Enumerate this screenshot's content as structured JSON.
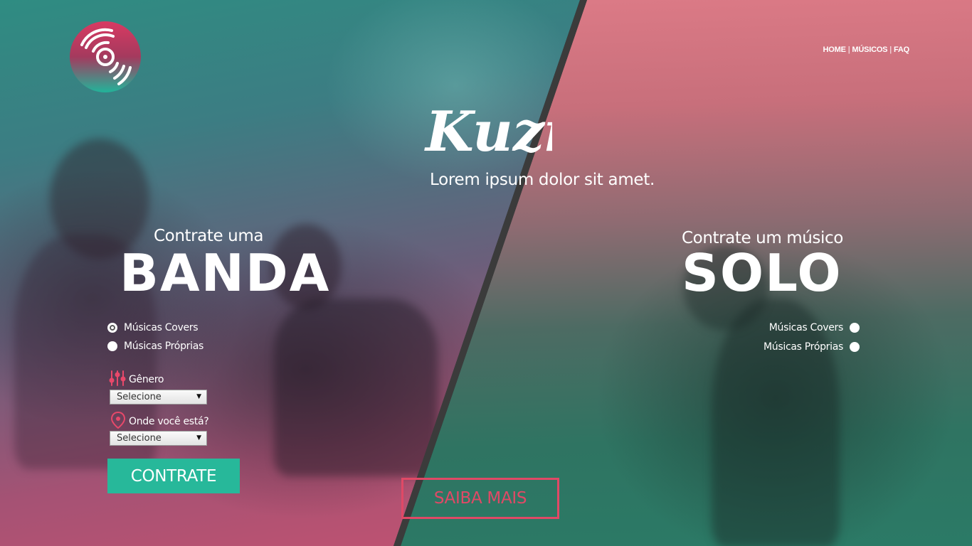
{
  "nav": {
    "home": "HOME",
    "musicos": "MÚSICOS",
    "faq": "FAQ",
    "separator": "|"
  },
  "brand": {
    "name": "Kuziq",
    "tagline": "Lorem ipsum dolor sit amet."
  },
  "banda": {
    "subtitle": "Contrate uma",
    "title": "BANDA",
    "options": [
      "Músicas Covers",
      "Músicas Próprias"
    ],
    "selected_option": "Músicas Covers",
    "genero_label": "Gênero",
    "genero_value": "Selecione",
    "local_label": "Onde você está?",
    "local_value": "Selecione",
    "cta": "CONTRATE"
  },
  "solo": {
    "subtitle": "Contrate um músico",
    "title": "SOLO",
    "options": [
      "Músicas Covers",
      "Músicas Próprias"
    ]
  },
  "saiba_mais": "SAIBA MAIS",
  "colors": {
    "teal_button": "#27b89a",
    "pink_accent": "#e04966",
    "divider": "#3b3b3b"
  },
  "icons": [
    "vinyl-disc-logo-icon",
    "equalizer-icon",
    "location-pin-icon",
    "caret-down-icon"
  ]
}
